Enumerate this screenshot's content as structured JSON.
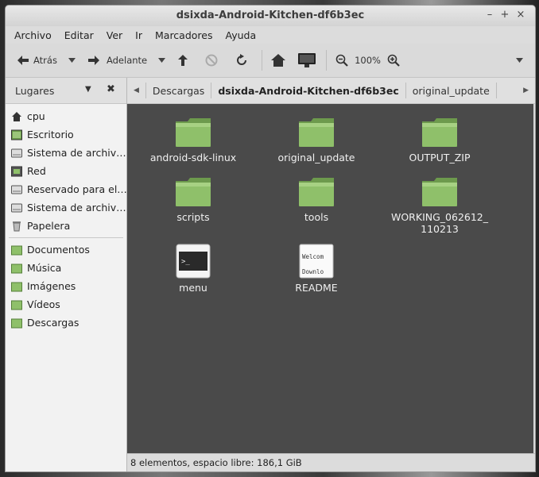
{
  "window": {
    "title": "dsixda-Android-Kitchen-df6b3ec"
  },
  "menubar": {
    "items": [
      "Archivo",
      "Editar",
      "Ver",
      "Ir",
      "Marcadores",
      "Ayuda"
    ]
  },
  "toolbar": {
    "back_label": "Atrás",
    "forward_label": "Adelante",
    "zoom_level": "100%"
  },
  "sidebar": {
    "header": "Lugares",
    "devices": [
      {
        "label": "cpu",
        "icon": "home-icon"
      },
      {
        "label": "Escritorio",
        "icon": "desktop-icon"
      },
      {
        "label": "Sistema de archiv…",
        "icon": "drive-icon"
      },
      {
        "label": "Red",
        "icon": "network-icon"
      },
      {
        "label": "Reservado para el…",
        "icon": "drive-icon"
      },
      {
        "label": "Sistema de archiv…",
        "icon": "drive-icon"
      },
      {
        "label": "Papelera",
        "icon": "trash-icon"
      }
    ],
    "bookmarks": [
      {
        "label": "Documentos",
        "icon": "folder-icon"
      },
      {
        "label": "Música",
        "icon": "folder-icon"
      },
      {
        "label": "Imágenes",
        "icon": "folder-icon"
      },
      {
        "label": "Vídeos",
        "icon": "folder-icon"
      },
      {
        "label": "Descargas",
        "icon": "folder-icon"
      }
    ]
  },
  "pathbar": {
    "crumbs": [
      "Descargas",
      "dsixda-Android-Kitchen-df6b3ec",
      "original_update"
    ]
  },
  "files": [
    {
      "name": "android-sdk-linux",
      "type": "folder"
    },
    {
      "name": "original_update",
      "type": "folder"
    },
    {
      "name": "OUTPUT_ZIP",
      "type": "folder"
    },
    {
      "name": "scripts",
      "type": "folder"
    },
    {
      "name": "tools",
      "type": "folder"
    },
    {
      "name": "WORKING_062612_\n110213",
      "type": "folder"
    },
    {
      "name": "menu",
      "type": "script"
    },
    {
      "name": "README",
      "type": "text",
      "preview_lines": [
        "Welcom",
        "Downlo"
      ]
    }
  ],
  "status": {
    "text": "8 elementos, espacio libre: 186,1 GiB"
  },
  "colors": {
    "folder_green": "#8fc06a",
    "content_bg": "#4a4a4a"
  }
}
